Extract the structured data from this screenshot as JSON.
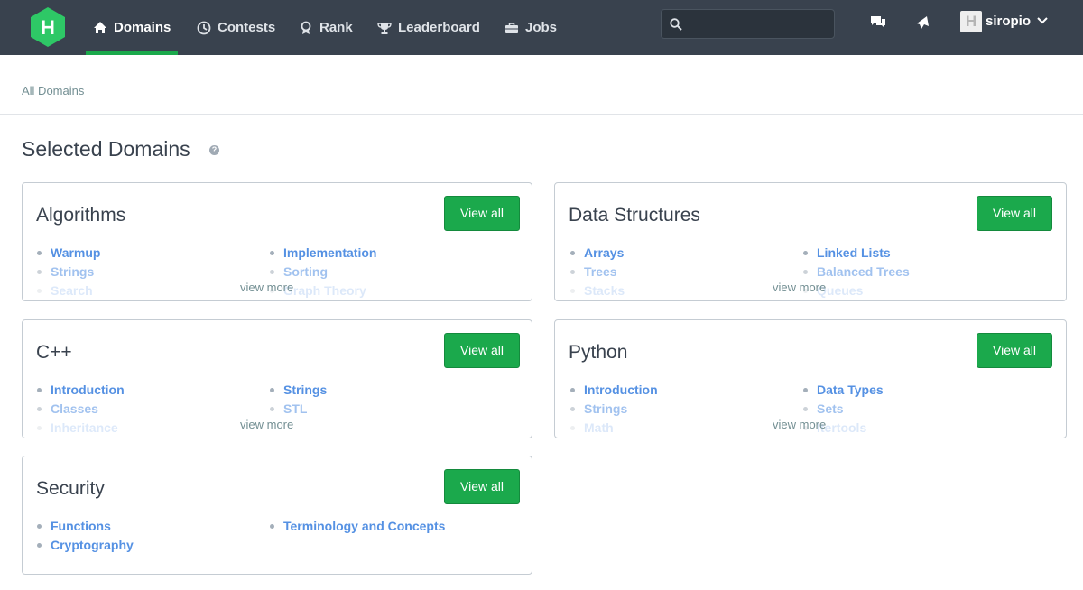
{
  "nav": {
    "logo_letter": "H",
    "items": [
      {
        "label": "Domains",
        "icon": "home-icon"
      },
      {
        "label": "Contests",
        "icon": "clock-icon"
      },
      {
        "label": "Rank",
        "icon": "medal-icon"
      },
      {
        "label": "Leaderboard",
        "icon": "trophy-icon"
      },
      {
        "label": "Jobs",
        "icon": "briefcase-icon"
      }
    ],
    "search_value": "",
    "username": "siropio",
    "avatar_letter": "H"
  },
  "breadcrumb": "All Domains",
  "page_title": "Selected Domains",
  "view_all_label": "View all",
  "view_more_label": "view more",
  "colors": {
    "accent": "#1ba94c",
    "nav_bg": "#39424e",
    "link": "#5591e3"
  },
  "domains": [
    {
      "title": "Algorithms",
      "left": [
        "Warmup",
        "Strings",
        "Search"
      ],
      "right": [
        "Implementation",
        "Sorting",
        "Graph Theory"
      ]
    },
    {
      "title": "Data Structures",
      "left": [
        "Arrays",
        "Trees",
        "Stacks"
      ],
      "right": [
        "Linked Lists",
        "Balanced Trees",
        "Queues"
      ]
    },
    {
      "title": "C++",
      "left": [
        "Introduction",
        "Classes",
        "Inheritance"
      ],
      "right": [
        "Strings",
        "STL",
        ""
      ]
    },
    {
      "title": "Python",
      "left": [
        "Introduction",
        "Strings",
        "Math"
      ],
      "right": [
        "Data Types",
        "Sets",
        "Itertools"
      ]
    },
    {
      "title": "Security",
      "left": [
        "Functions",
        "Cryptography"
      ],
      "right": [
        "Terminology and Concepts"
      ]
    }
  ]
}
